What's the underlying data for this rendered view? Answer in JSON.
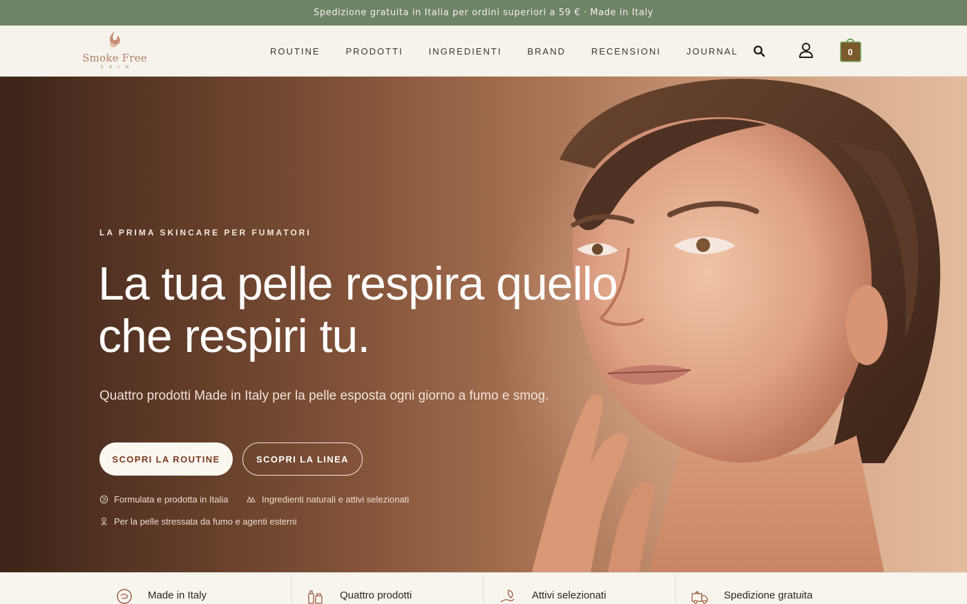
{
  "announcement": {
    "text": "Spedizione gratuita in Italia per ordini superiori a 59 € · Made in Italy"
  },
  "brand": {
    "name": "Smoke Free",
    "sub": "SKIN"
  },
  "nav": {
    "items": [
      {
        "label": "ROUTINE"
      },
      {
        "label": "PRODOTTI"
      },
      {
        "label": "INGREDIENTI"
      },
      {
        "label": "BRAND"
      },
      {
        "label": "RECENSIONI"
      },
      {
        "label": "JOURNAL"
      }
    ]
  },
  "header": {
    "icons": [
      "search-icon",
      "account-icon",
      "cart-icon"
    ],
    "cart_count": "0"
  },
  "hero": {
    "eyebrow": "LA PRIMA SKINCARE PER FUMATORI",
    "headline_line1": "La tua pelle respira quello",
    "headline_line2": "che respiri tu.",
    "subhead": "Quattro prodotti Made in Italy per la pelle esposta ogni giorno a fumo e smog.",
    "primary_cta": "SCOPRI LA ROUTINE",
    "secondary_cta": "SCOPRI LA LINEA",
    "features": [
      {
        "icon": "made-in-italy-icon",
        "text": "Formulata e prodotta in Italia"
      },
      {
        "icon": "ingredients-icon",
        "text": "Ingredienti naturali e attivi selezionati"
      },
      {
        "icon": "protection-icon",
        "text": "Per la pelle stressata da fumo e agenti esterni"
      }
    ]
  },
  "strip": {
    "items": [
      {
        "icon": "italy-badge-icon",
        "label": "Made in Italy"
      },
      {
        "icon": "bottles-icon",
        "label": "Quattro prodotti"
      },
      {
        "icon": "leaf-hand-icon",
        "label": "Attivi selezionati"
      },
      {
        "icon": "free-shipping-truck-icon",
        "label": "Spedizione gratuita"
      }
    ]
  },
  "colors": {
    "announcement_bg": "#6f8466",
    "header_bg": "#f6f3ec",
    "brand_accent": "#b27f68",
    "cart_bg": "#7a5a2a",
    "cart_handle": "#6fa25a",
    "primary_cta_text": "#7a3b1f"
  }
}
